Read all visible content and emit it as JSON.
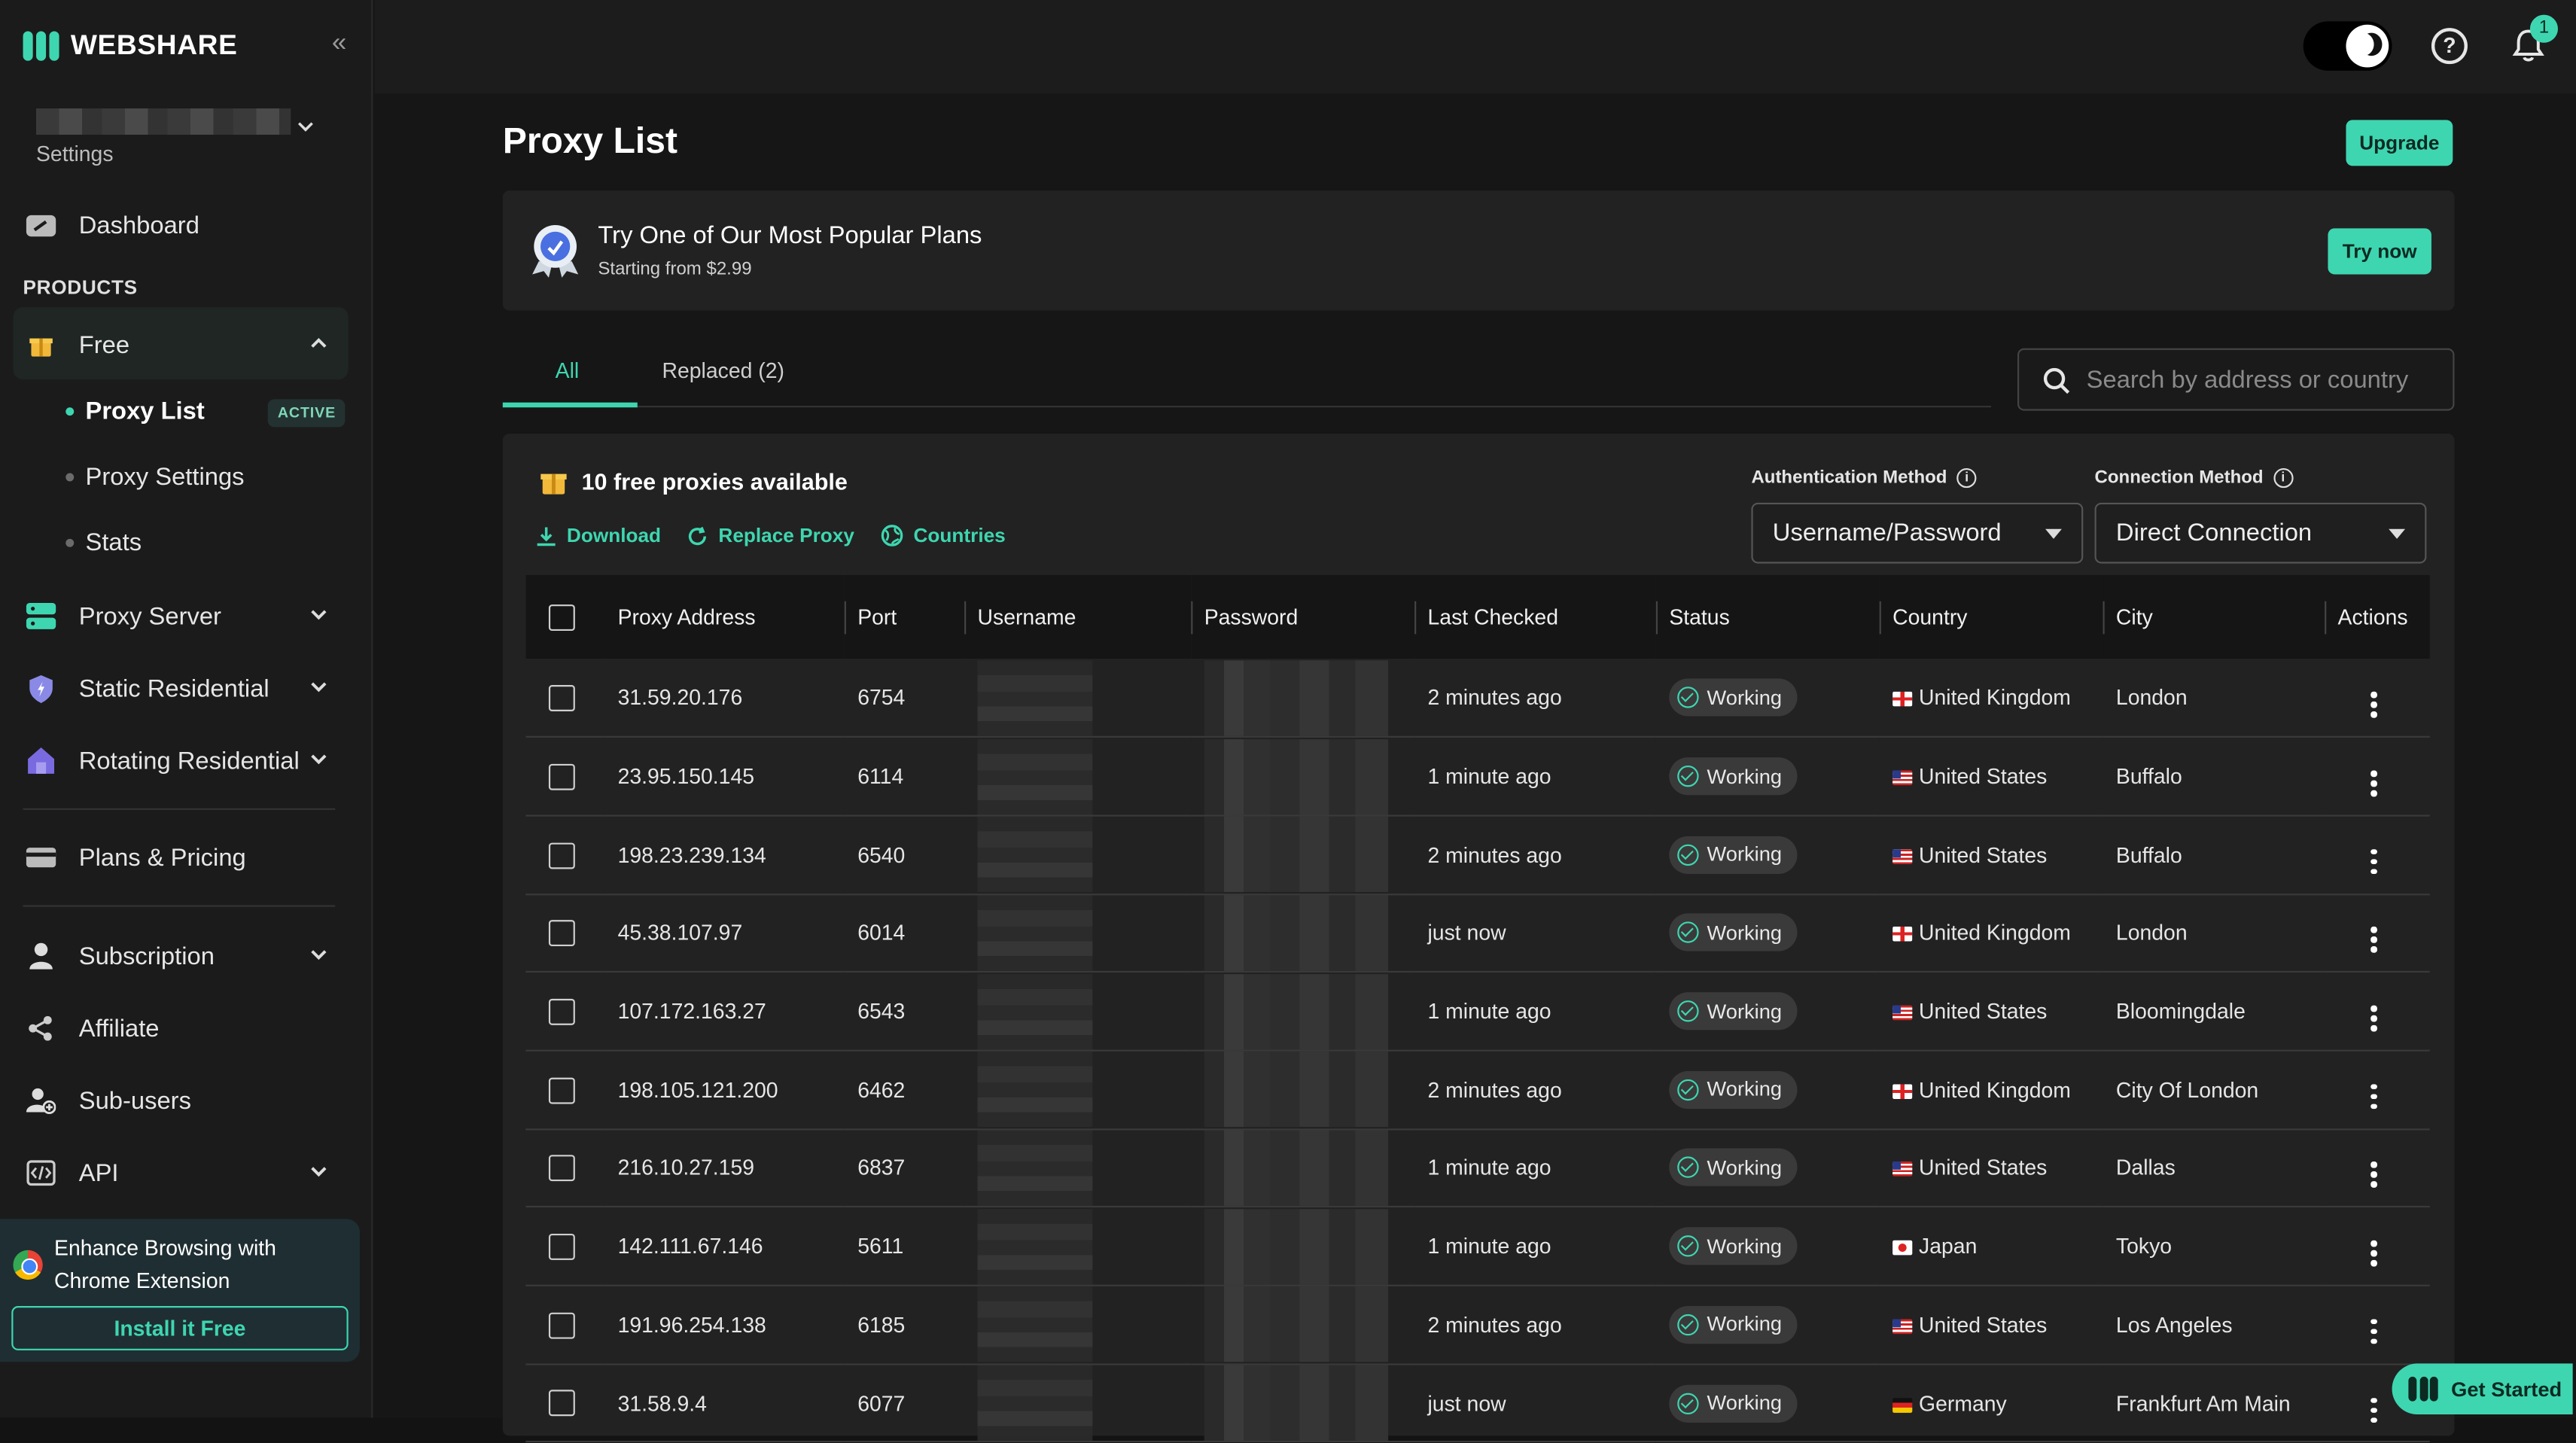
{
  "brand": {
    "name": "WEBSHARE"
  },
  "sidebar": {
    "settings_label": "Settings",
    "dashboard": "Dashboard",
    "products_label": "PRODUCTS",
    "free": "Free",
    "sub_items": [
      {
        "label": "Proxy List",
        "active": true,
        "badge": "ACTIVE"
      },
      {
        "label": "Proxy Settings"
      },
      {
        "label": "Stats"
      }
    ],
    "items": [
      {
        "label": "Proxy Server"
      },
      {
        "label": "Static Residential"
      },
      {
        "label": "Rotating Residential"
      },
      {
        "label": "Plans & Pricing"
      },
      {
        "label": "Subscription"
      },
      {
        "label": "Affiliate"
      },
      {
        "label": "Sub-users"
      },
      {
        "label": "API"
      }
    ],
    "promo": {
      "text": "Enhance Browsing with Chrome Extension",
      "button": "Install it Free"
    }
  },
  "topbar": {
    "notifications_count": "1"
  },
  "page": {
    "title": "Proxy List",
    "upgrade": "Upgrade",
    "plans_banner": {
      "title": "Try One of Our Most Popular Plans",
      "subtitle": "Starting from $2.99",
      "button": "Try now"
    },
    "tabs": [
      {
        "label": "All",
        "active": true
      },
      {
        "label": "Replaced (2)"
      }
    ],
    "search_placeholder": "Search by address or country",
    "free_count": "10 free proxies available",
    "actions": {
      "download": "Download",
      "replace": "Replace Proxy",
      "countries": "Countries"
    },
    "auth": {
      "label": "Authentication Method",
      "value": "Username/Password"
    },
    "connection": {
      "label": "Connection Method",
      "value": "Direct Connection"
    },
    "columns": [
      "Proxy Address",
      "Port",
      "Username",
      "Password",
      "Last Checked",
      "Status",
      "Country",
      "City",
      "Actions"
    ],
    "rows": [
      {
        "address": "31.59.20.176",
        "port": "6754",
        "checked": "2 minutes ago",
        "status": "Working",
        "flag": "uk",
        "country": "United Kingdom",
        "city": "London"
      },
      {
        "address": "23.95.150.145",
        "port": "6114",
        "checked": "1 minute ago",
        "status": "Working",
        "flag": "us",
        "country": "United States",
        "city": "Buffalo"
      },
      {
        "address": "198.23.239.134",
        "port": "6540",
        "checked": "2 minutes ago",
        "status": "Working",
        "flag": "us",
        "country": "United States",
        "city": "Buffalo"
      },
      {
        "address": "45.38.107.97",
        "port": "6014",
        "checked": "just now",
        "status": "Working",
        "flag": "uk",
        "country": "United Kingdom",
        "city": "London"
      },
      {
        "address": "107.172.163.27",
        "port": "6543",
        "checked": "1 minute ago",
        "status": "Working",
        "flag": "us",
        "country": "United States",
        "city": "Bloomingdale"
      },
      {
        "address": "198.105.121.200",
        "port": "6462",
        "checked": "2 minutes ago",
        "status": "Working",
        "flag": "uk",
        "country": "United Kingdom",
        "city": "City Of London"
      },
      {
        "address": "216.10.27.159",
        "port": "6837",
        "checked": "1 minute ago",
        "status": "Working",
        "flag": "us",
        "country": "United States",
        "city": "Dallas"
      },
      {
        "address": "142.111.67.146",
        "port": "5611",
        "checked": "1 minute ago",
        "status": "Working",
        "flag": "jp",
        "country": "Japan",
        "city": "Tokyo"
      },
      {
        "address": "191.96.254.138",
        "port": "6185",
        "checked": "2 minutes ago",
        "status": "Working",
        "flag": "us",
        "country": "United States",
        "city": "Los Angeles"
      },
      {
        "address": "31.58.9.4",
        "port": "6077",
        "checked": "just now",
        "status": "Working",
        "flag": "de",
        "country": "Germany",
        "city": "Frankfurt Am Main"
      }
    ]
  },
  "get_started": "Get Started",
  "colors": {
    "accent": "#3ed6b0",
    "background": "#161616",
    "panel": "#222222"
  }
}
